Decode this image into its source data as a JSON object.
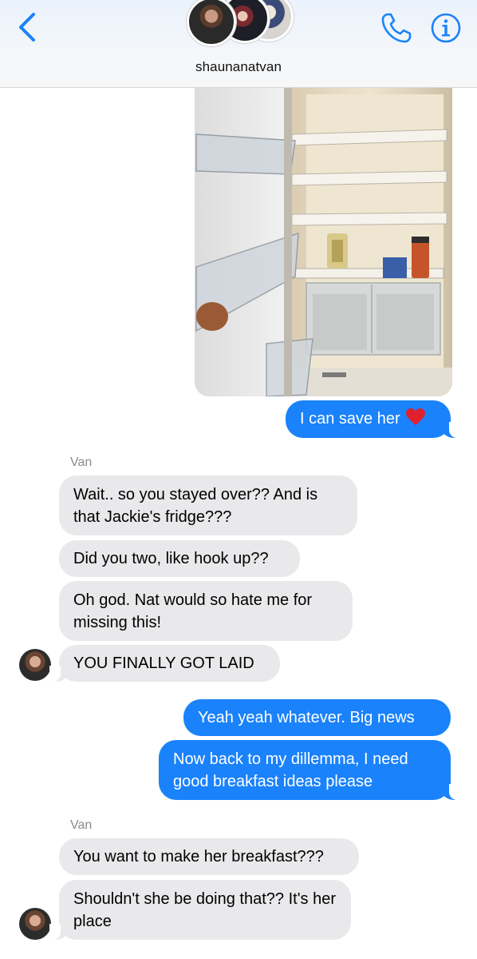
{
  "header": {
    "contact_name": "shaunanatvan",
    "back_icon": "chevron-left-icon",
    "call_icon": "phone-icon",
    "info_icon": "info-icon",
    "accent_color": "#1a82fb"
  },
  "messages": {
    "m1_out": "I can save her",
    "sender_label_1": "Van",
    "m2_in": "Wait.. so you stayed over?? And is that Jackie's fridge???",
    "m3_in": "Did you two, like hook up??",
    "m4_in": "Oh god. Nat would so hate me for missing this!",
    "m5_in": "YOU FINALLY GOT LAID",
    "m6_out": "Yeah yeah whatever. Big news",
    "m7_out": "Now back to my dillemma, I need good breakfast ideas please",
    "sender_label_2": "Van",
    "m8_in": "You want to make her breakfast???",
    "m9_in": "Shouldn't she be doing that?? It's her place"
  },
  "colors": {
    "outgoing_bubble": "#1a82fb",
    "incoming_bubble": "#e9e9eb",
    "heart": "#e0202f"
  }
}
